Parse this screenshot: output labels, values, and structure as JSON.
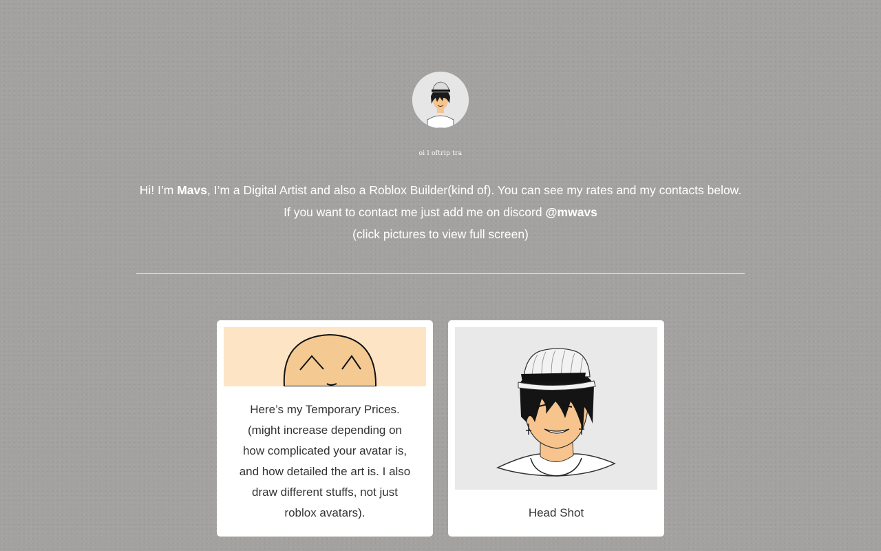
{
  "profile": {
    "avatar_icon": "artist-avatar-portrait",
    "tagline": "oi l oftrip tra"
  },
  "intro": {
    "greeting": "Hi! I’m ",
    "name": "Mavs",
    "text_after_name": ", I’m a Digital Artist and also a Roblox Builder(kind of). You can see my rates and my contacts below. If you want to contact me just add me on discord ",
    "discord_handle": "@mwavs",
    "hint": "(click pictures to view full screen)"
  },
  "cards": [
    {
      "image_icon": "smiling-face-drawing",
      "caption": "Here’s my Temporary Prices. (might increase depending on how complicated your avatar is, and how detailed the art is. I also draw different stuffs, not just roblox avatars)."
    },
    {
      "image_icon": "headshot-portrait-drawing",
      "caption": "Head Shot"
    }
  ],
  "colors": {
    "background": "#a3a2a1",
    "card": "#ffffff",
    "card_text": "#333333",
    "prices_image_bg": "#fde4c4",
    "face_fill": "#f4ca92"
  }
}
